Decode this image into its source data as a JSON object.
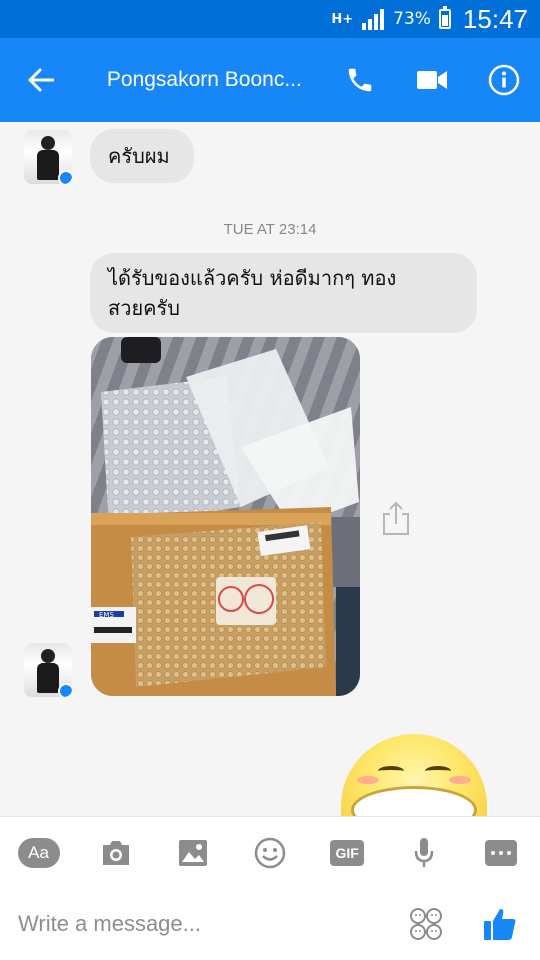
{
  "status_bar": {
    "network": "H+",
    "battery_percent": "73%",
    "time": "15:47"
  },
  "header": {
    "contact_name": "Pongsakorn Boonc...",
    "back_icon": "back-arrow-icon",
    "call_icon": "phone-icon",
    "video_icon": "video-camera-icon",
    "info_icon": "info-icon"
  },
  "messages": {
    "first": {
      "text": "ครับผม"
    },
    "timestamp": "TUE AT 23:14",
    "second": {
      "line1": "ได้รับของแล้วครับ ห่อดีมากๆ ทอง",
      "line2": "สวยครับ"
    },
    "photo_label": "EMS"
  },
  "toolbar": {
    "text_style_label": "Aa",
    "gif_label": "GIF",
    "items": [
      "text-style",
      "camera",
      "gallery",
      "emoji",
      "gif",
      "microphone",
      "more"
    ]
  },
  "composer": {
    "placeholder": "Write a message..."
  },
  "colors": {
    "header": "#1786f6",
    "status_bar": "#0070d8",
    "like": "#1786f6",
    "bubble": "#e6e6e6"
  }
}
